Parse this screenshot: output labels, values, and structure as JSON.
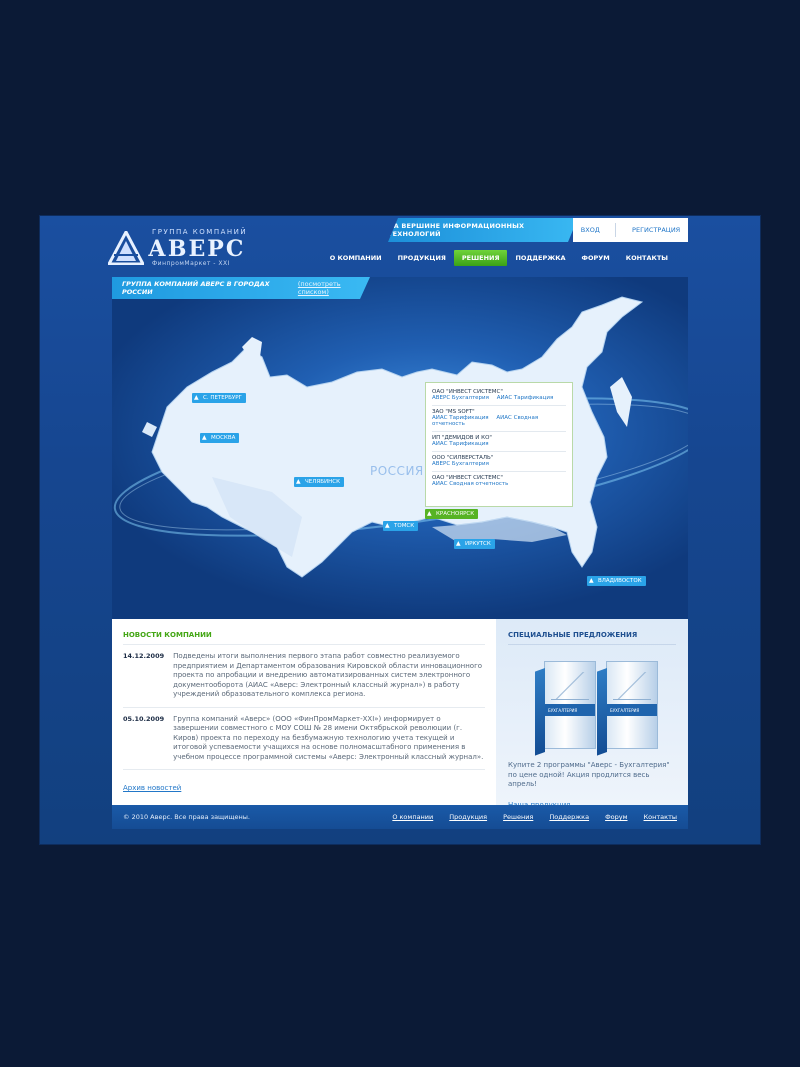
{
  "header": {
    "group_label": "ГРУППА КОМПАНИЙ",
    "brand": "АВЕРС",
    "subtitle": "ФинпромМаркет - XXI",
    "slogan": "На вершине информационных технологий",
    "login": "Вход",
    "register": "Регистрация"
  },
  "nav": {
    "items": [
      "О компании",
      "Продукция",
      "Решения",
      "Поддержка",
      "Форум",
      "Контакты"
    ],
    "active": "Решения"
  },
  "map": {
    "title": "Группа компаний Аверс в городах России",
    "list_link": "(посмотреть списком)",
    "country_label": "РОССИЯ",
    "cities": [
      "С. Петербург",
      "Москва",
      "Челябинск",
      "Томск",
      "Красноярск",
      "Иркутск",
      "Владивосток"
    ],
    "active_city": "Красноярск",
    "popup": [
      {
        "org": "ОАО \"ИНВЕСТ СИСТЕМС\"",
        "products": [
          "АВЕРС Бухгалтерия",
          "АИАС Тарификация"
        ]
      },
      {
        "org": "ЗАО \"MS SOFT\"",
        "products": [
          "АИАС Тарификация",
          "АИАС Сводная отчетность"
        ]
      },
      {
        "org": "ИП \"ДЕМИДОВ И КО\"",
        "products": [
          "АИАС Тарификация"
        ]
      },
      {
        "org": "ООО \"СИЛВЕРСТАЛЬ\"",
        "products": [
          "АВЕРС Бухгалтерия"
        ]
      },
      {
        "org": "ОАО \"ИНВЕСТ СИСТЕМС\"",
        "products": [
          "АИАС Сводная отчетность"
        ]
      }
    ]
  },
  "news": {
    "heading": "Новости компании",
    "items": [
      {
        "date": "14.12.2009",
        "text": "Подведены итоги выполнения первого этапа работ совместно реализуемого предприятием и Департаментом образования Кировской области инновационного проекта  по апробации и внедрению автоматизированных систем электронного документооборота (АИАС «Аверс: Электронный классный журнал») в работу учреждений образовательного комплекса региона."
      },
      {
        "date": "05.10.2009",
        "text": "Группа  компаний «Аверс» (ООО «ФинПромМаркет-XXI») информирует о завершении совместного с МОУ СОШ № 28 имени Октябрьской революции (г. Киров) проекта по переходу на безбумажную технологию учета текущей и итоговой успеваемости учащихся на основе полномасштабного применения в учебном процессе программной системы «Аверс: Электронный классный журнал»."
      }
    ],
    "archive": "Архив новостей"
  },
  "offers": {
    "heading": "Специальные предложения",
    "box_label": "БУХГАЛТЕРИЯ",
    "description": "Купите 2 программы \"Аверс - Бухгалтерия\" по цене одной! Акция продлится весь апрель!",
    "link": "Наша продукция"
  },
  "footer": {
    "copyright": "© 2010 Аверс. Все права защищены.",
    "links": [
      "О компании",
      "Продукция",
      "Решения",
      "Поддержка",
      "Форум",
      "Контакты"
    ]
  },
  "colors": {
    "page_bg": "#0b1a36",
    "frame_blue": "#1a4fa0",
    "accent_cyan": "#2aa3e8",
    "accent_green": "#56b324",
    "news_heading": "#43a614"
  }
}
